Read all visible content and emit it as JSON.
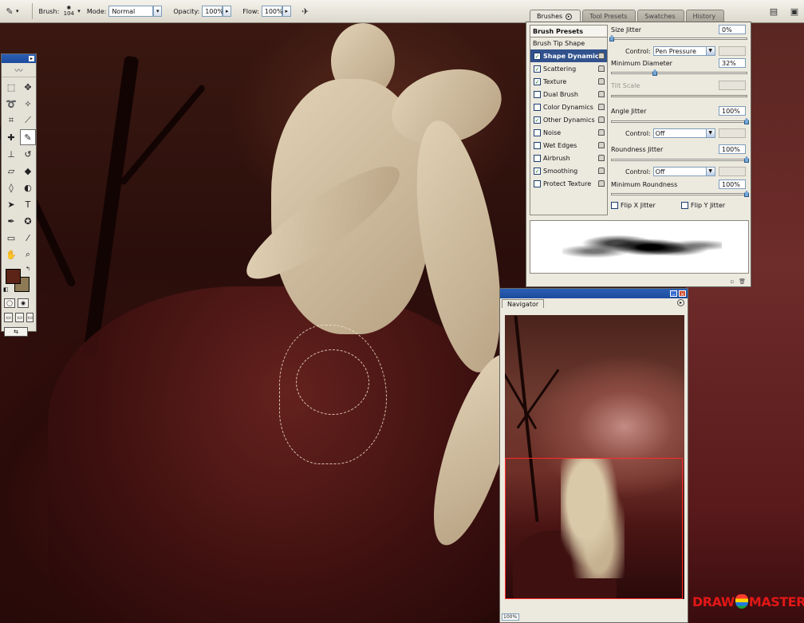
{
  "options_bar": {
    "brush_label": "Brush:",
    "brush_size": "104",
    "mode_label": "Mode:",
    "mode_value": "Normal",
    "opacity_label": "Opacity:",
    "opacity_value": "100%",
    "flow_label": "Flow:",
    "flow_value": "100%"
  },
  "palette_well": {
    "tabs": [
      "Brushes",
      "Tool Presets",
      "Swatches",
      "History"
    ]
  },
  "brushes_panel": {
    "presets_button": "Brush Presets",
    "tip_shape": "Brush Tip Shape",
    "options": [
      {
        "label": "Shape Dynamics",
        "checked": true,
        "selected": true
      },
      {
        "label": "Scattering",
        "checked": true
      },
      {
        "label": "Texture",
        "checked": true
      },
      {
        "label": "Dual Brush",
        "checked": false
      },
      {
        "label": "Color Dynamics",
        "checked": false
      },
      {
        "label": "Other Dynamics",
        "checked": true
      },
      {
        "label": "Noise",
        "checked": false
      },
      {
        "label": "Wet Edges",
        "checked": false
      },
      {
        "label": "Airbrush",
        "checked": false
      },
      {
        "label": "Smoothing",
        "checked": true
      },
      {
        "label": "Protect Texture",
        "checked": false
      }
    ],
    "size_jitter_label": "Size Jitter",
    "size_jitter_value": "0%",
    "size_jitter_level": 0,
    "control_label": "Control:",
    "size_control_value": "Pen Pressure",
    "minimum_diameter_label": "Minimum Diameter",
    "minimum_diameter_value": "32%",
    "minimum_diameter_level": 0.32,
    "tilt_scale_label": "Tilt Scale",
    "angle_jitter_label": "Angle Jitter",
    "angle_jitter_value": "100%",
    "angle_jitter_level": 1,
    "angle_control_value": "Off",
    "roundness_jitter_label": "Roundness Jitter",
    "roundness_jitter_value": "100%",
    "roundness_jitter_level": 1,
    "roundness_control_value": "Off",
    "minimum_roundness_label": "Minimum Roundness",
    "minimum_roundness_value": "100%",
    "minimum_roundness_level": 1,
    "flip_x_label": "Flip X Jitter",
    "flip_y_label": "Flip Y Jitter"
  },
  "navigator": {
    "tab": "Navigator",
    "zoom_value": "100%"
  },
  "toolbox": {
    "foreground_color": "#5b2417",
    "background_color": "#8e7a54"
  },
  "watermark": {
    "left": "DRAW",
    "right": "MASTER.RU"
  }
}
